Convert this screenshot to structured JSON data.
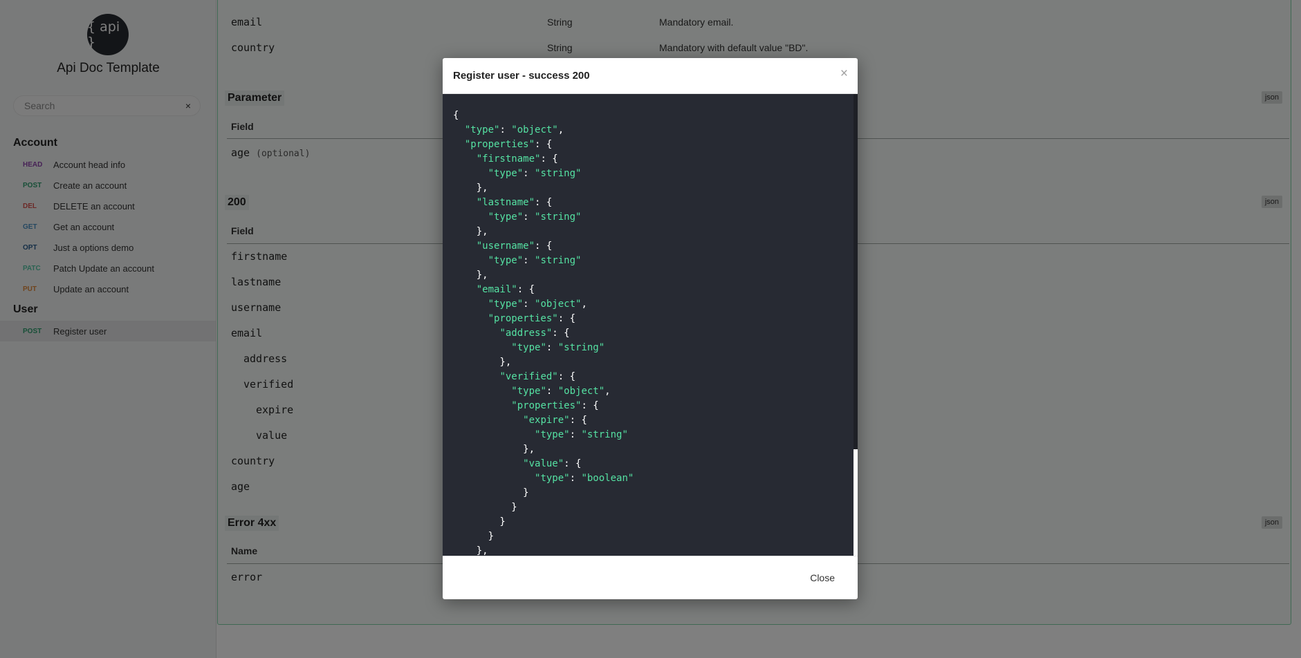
{
  "sidebar": {
    "logo_text": "{ api }",
    "title": "Api Doc Template",
    "search": {
      "placeholder": "Search",
      "clear_label": "×"
    },
    "groups": [
      {
        "label": "Account",
        "items": [
          {
            "method": "HEAD",
            "label": "Account head info",
            "color": "#8e44ad"
          },
          {
            "method": "POST",
            "label": "Create an account",
            "color": "#2e9e6f"
          },
          {
            "method": "DEL",
            "label": "DELETE an account",
            "color": "#d9534f"
          },
          {
            "method": "GET",
            "label": "Get an account",
            "color": "#4a90c2"
          },
          {
            "method": "OPT",
            "label": "Just a options demo",
            "color": "#2b5e8e"
          },
          {
            "method": "PATC",
            "label": "Patch Update an account",
            "color": "#55c7a5"
          },
          {
            "method": "PUT",
            "label": "Update an account",
            "color": "#e0883a"
          }
        ]
      },
      {
        "label": "User",
        "items": [
          {
            "method": "POST",
            "label": "Register user",
            "color": "#2e9e6f",
            "active": true
          }
        ]
      }
    ]
  },
  "main": {
    "top_rows": [
      {
        "field": "email",
        "type": "String",
        "desc": "Mandatory email."
      },
      {
        "field": "country",
        "type": "String",
        "desc": "Mandatory with default value \"BD\"."
      }
    ],
    "sections": [
      {
        "title": "Parameter",
        "json_label": "json",
        "header": "Field",
        "rows": [
          {
            "field": "age",
            "note": "(optional)"
          }
        ]
      },
      {
        "title": "200",
        "json_label": "json",
        "header": "Field",
        "rows": [
          {
            "field": "firstname"
          },
          {
            "field": "lastname"
          },
          {
            "field": "username"
          },
          {
            "field": "email"
          },
          {
            "field": "address"
          },
          {
            "field": "verified"
          },
          {
            "field": "expire"
          },
          {
            "field": "value"
          },
          {
            "field": "country"
          },
          {
            "field": "age"
          }
        ]
      },
      {
        "title": "Error 4xx",
        "json_label": "json",
        "header": "Name",
        "rows": [
          {
            "field": "error"
          }
        ]
      }
    ]
  },
  "modal": {
    "title": "Register user - success 200",
    "close_x": "×",
    "close_button": "Close",
    "code": "{\n  \"type\": \"object\",\n  \"properties\": {\n    \"firstname\": {\n      \"type\": \"string\"\n    },\n    \"lastname\": {\n      \"type\": \"string\"\n    },\n    \"username\": {\n      \"type\": \"string\"\n    },\n    \"email\": {\n      \"type\": \"object\",\n      \"properties\": {\n        \"address\": {\n          \"type\": \"string\"\n        },\n        \"verified\": {\n          \"type\": \"object\",\n          \"properties\": {\n            \"expire\": {\n              \"type\": \"string\"\n            },\n            \"value\": {\n              \"type\": \"boolean\"\n            }\n          }\n        }\n      }\n    },"
  }
}
